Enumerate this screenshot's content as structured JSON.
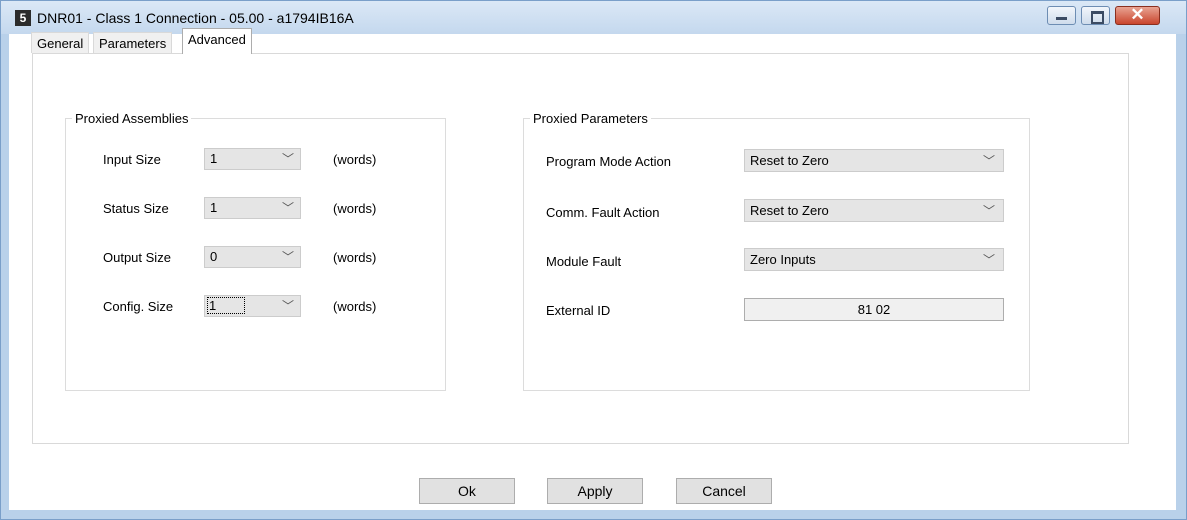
{
  "window": {
    "title": "DNR01 - Class 1 Connection - 05.00 - a1794IB16A",
    "app_icon_glyph": "5",
    "controls": {
      "minimize": "minimize-icon",
      "maximize": "maximize-icon",
      "close": "close-icon",
      "close_glyph": "✕"
    }
  },
  "tabs": [
    {
      "label": "General",
      "active": false
    },
    {
      "label": "Parameters",
      "active": false
    },
    {
      "label": "Advanced",
      "active": true
    }
  ],
  "proxied_assemblies": {
    "title": "Proxied Assemblies",
    "rows": [
      {
        "label": "Input Size",
        "value": "1",
        "unit": "(words)"
      },
      {
        "label": "Status Size",
        "value": "1",
        "unit": "(words)"
      },
      {
        "label": "Output Size",
        "value": "0",
        "unit": "(words)"
      },
      {
        "label": "Config. Size",
        "value": "1",
        "unit": "(words)",
        "focused": true
      }
    ]
  },
  "proxied_parameters": {
    "title": "Proxied Parameters",
    "program_mode_action": {
      "label": "Program Mode Action",
      "value": "Reset to Zero"
    },
    "comm_fault_action": {
      "label": "Comm. Fault Action",
      "value": "Reset to Zero"
    },
    "module_fault": {
      "label": "Module Fault",
      "value": "Zero Inputs"
    },
    "external_id": {
      "label": "External ID",
      "value": "81 02"
    }
  },
  "buttons": {
    "ok": "Ok",
    "apply": "Apply",
    "cancel": "Cancel"
  },
  "colors": {
    "title_bar": "#c4d8ee",
    "close_button": "#c9452d",
    "combo_fill": "#e5e5e5"
  },
  "dropdown_arrow_glyph": "﹀"
}
